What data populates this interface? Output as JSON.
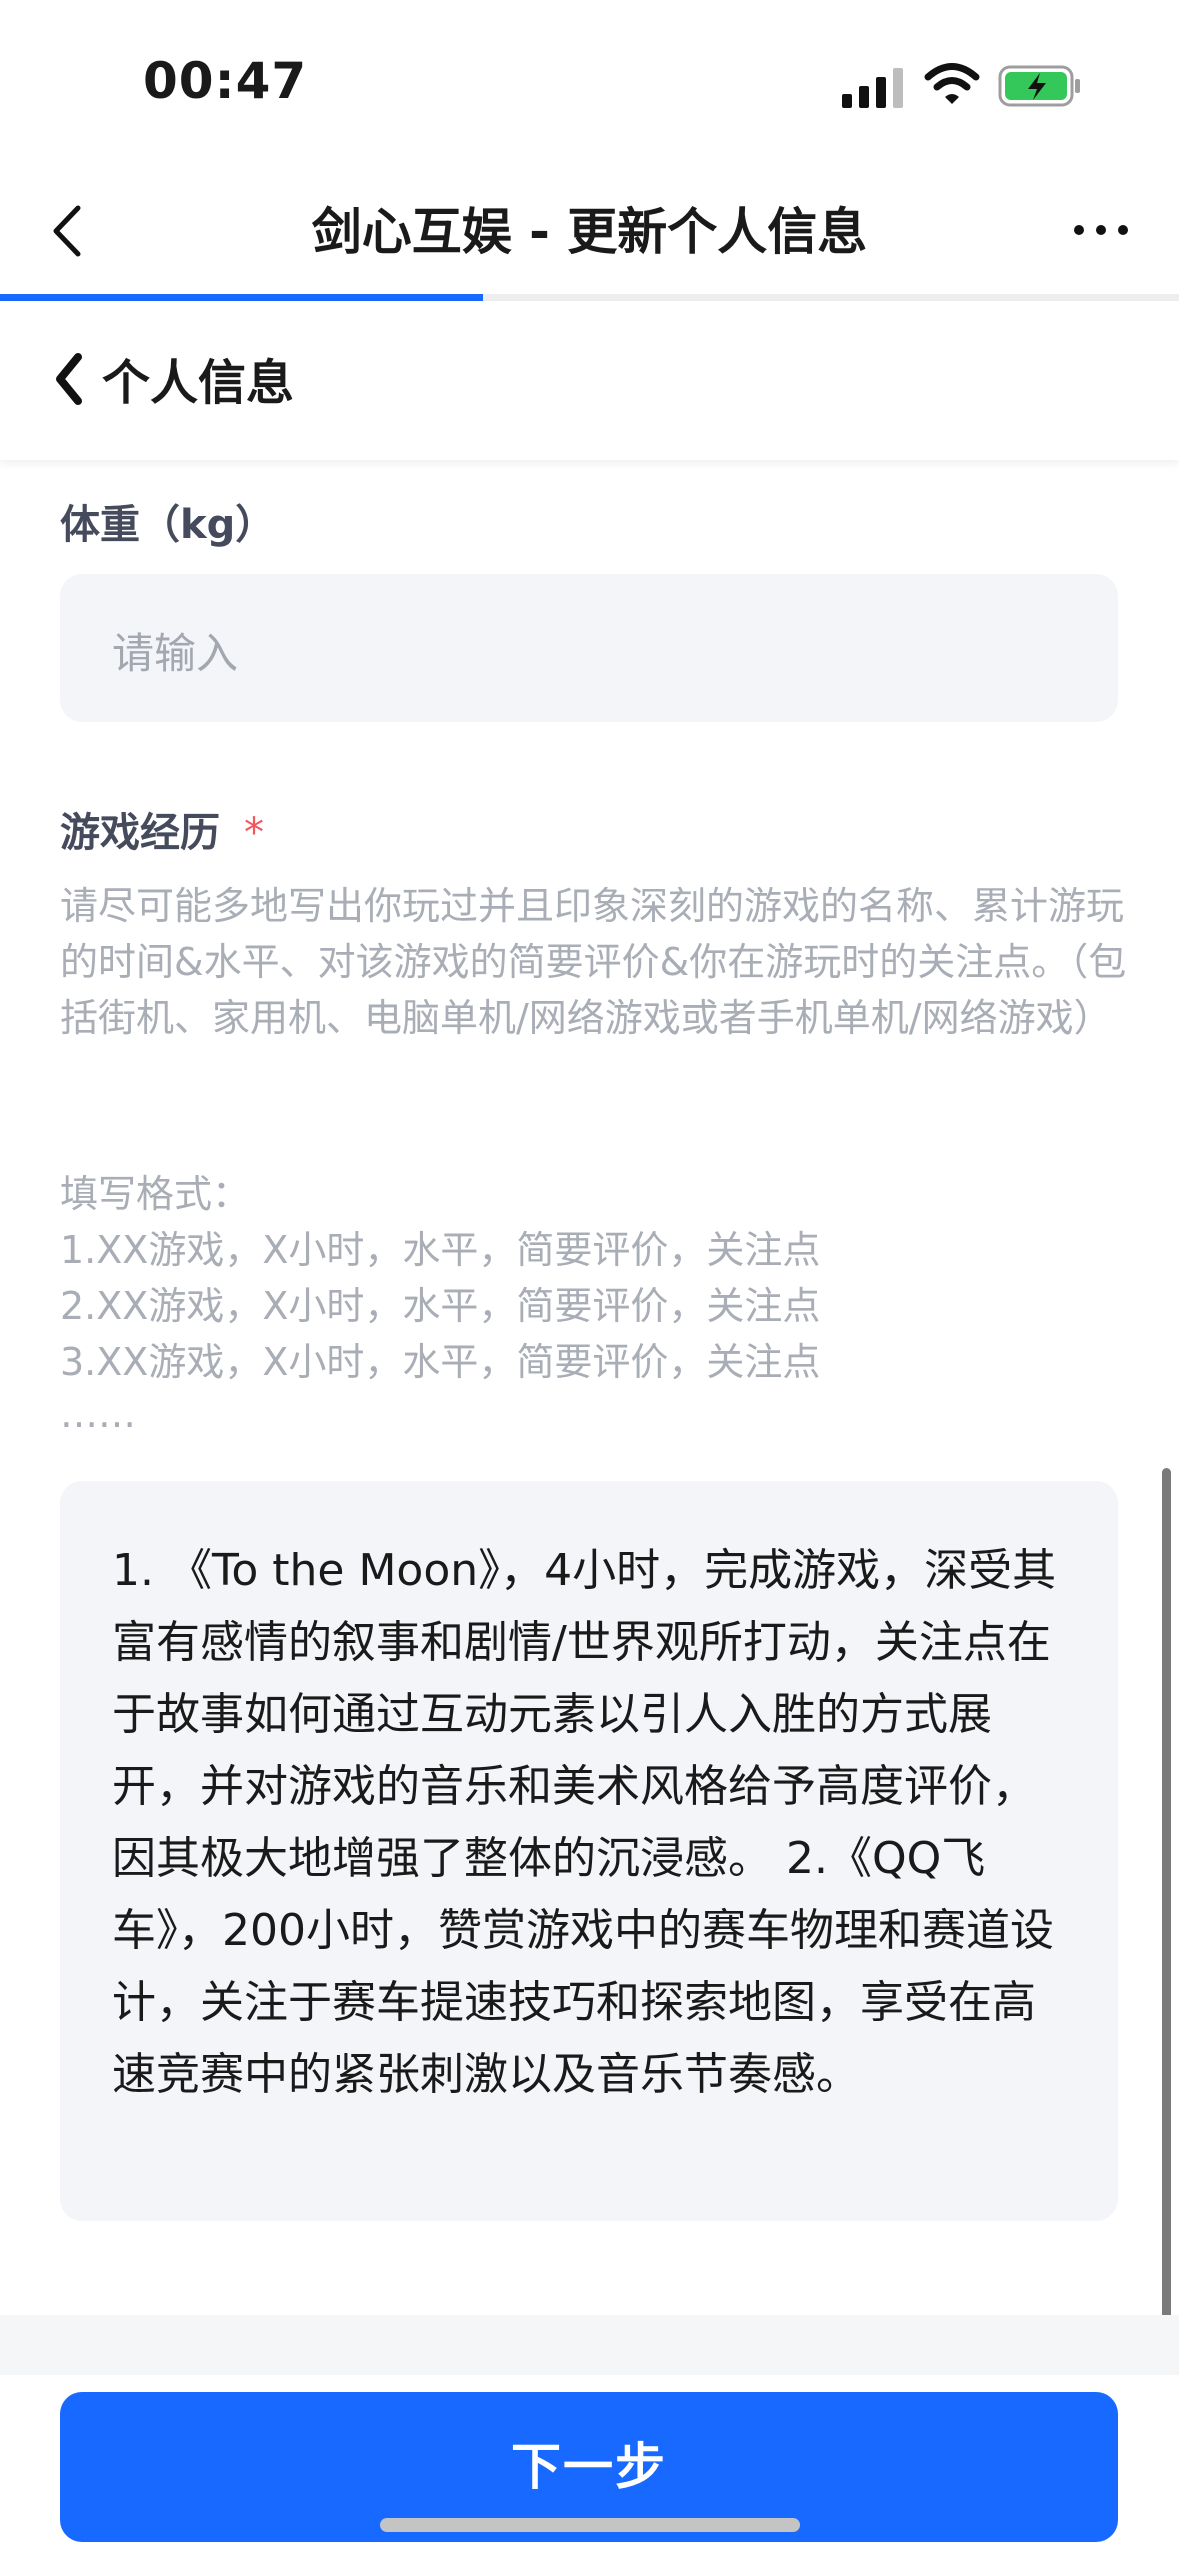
{
  "status_bar": {
    "time": "00:47",
    "icons": [
      "signal-icon",
      "wifi-icon",
      "battery-charging-icon"
    ],
    "battery_color": "#34c759"
  },
  "nav": {
    "title": "剑心互娱 - 更新个人信息",
    "back_icon": "chevron-left-icon",
    "more_icon": "more-icon",
    "progress_fraction": 0.41,
    "accent_color": "#1769ff"
  },
  "section": {
    "title": "个人信息",
    "back_icon": "chevron-left-icon"
  },
  "form": {
    "weight": {
      "label": "体重（kg）",
      "placeholder": "请输入",
      "value": ""
    },
    "game_experience": {
      "label": "游戏经历",
      "required_mark": "*",
      "hint": "请尽可能多地写出你玩过并且印象深刻的游戏的名称、累计游玩的时间&水平、对该游戏的简要评价&你在游玩时的关注点。（包括街机、家用机、电脑单机/网络游戏或者手机单机/网络游戏）",
      "format_title": "填写格式：",
      "format_lines": [
        "1.XX游戏，X小时，水平，简要评价，关注点",
        "2.XX游戏，X小时，水平，简要评价，关注点",
        "3.XX游戏，X小时，水平，简要评价，关注点",
        "……"
      ],
      "value": "1. 《To the Moon》，4小时，完成游戏，深受其富有感情的叙事和剧情/世界观所打动，关注点在于故事如何通过互动元素以引人入胜的方式展开，并对游戏的音乐和美术风格给予高度评价，因其极大地增强了整体的沉浸感。 2.《QQ飞车》，200小时，赞赏游戏中的赛车物理和赛道设计，关注于赛车提速技巧和探索地图，享受在高速竞赛中的紧张刺激以及音乐节奏感。"
    }
  },
  "footer": {
    "next_label": "下一步"
  }
}
